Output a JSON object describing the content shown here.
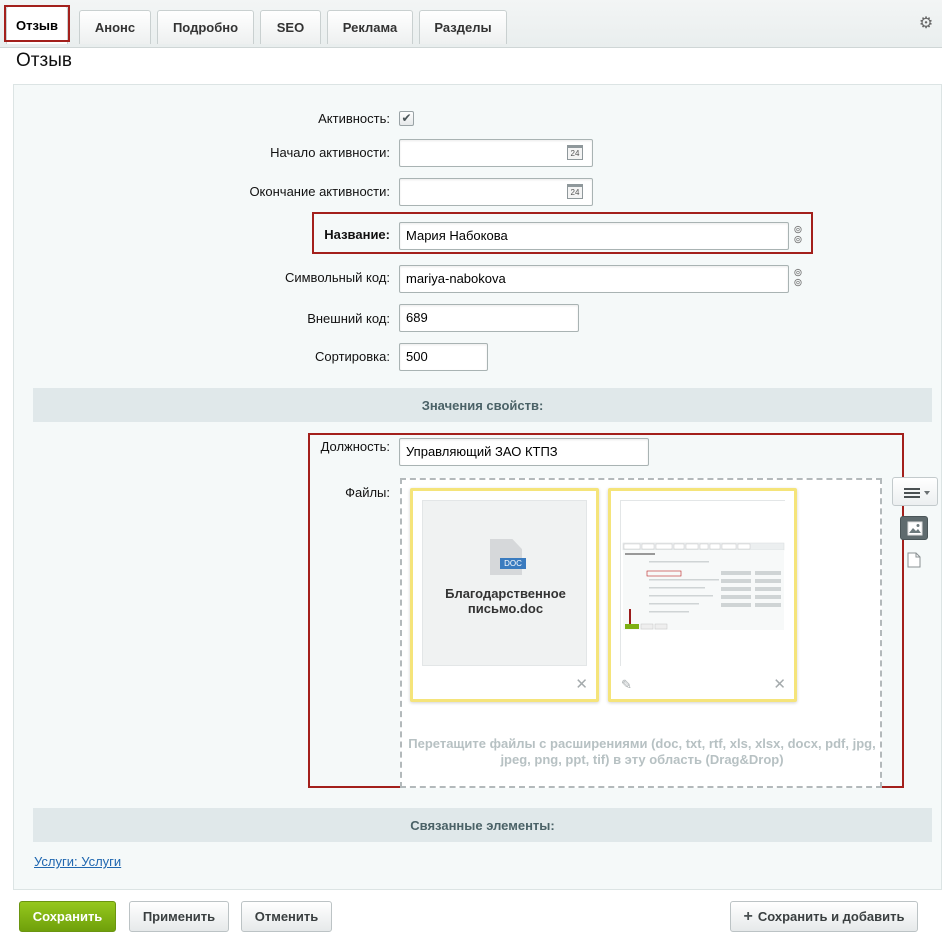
{
  "tabs": [
    {
      "label": "Отзыв",
      "active": true
    },
    {
      "label": "Анонс",
      "active": false
    },
    {
      "label": "Подробно",
      "active": false
    },
    {
      "label": "SEO",
      "active": false
    },
    {
      "label": "Реклама",
      "active": false
    },
    {
      "label": "Разделы",
      "active": false
    }
  ],
  "page_title": "Отзыв",
  "form": {
    "active_label": "Активность:",
    "active_checked": true,
    "active_from_label": "Начало активности:",
    "active_from_value": "",
    "active_to_label": "Окончание активности:",
    "active_to_value": "",
    "name_label": "Название:",
    "name_value": "Мария Набокова",
    "code_label": "Символьный код:",
    "code_value": "mariya-nabokova",
    "xml_id_label": "Внешний код:",
    "xml_id_value": "689",
    "sort_label": "Сортировка:",
    "sort_value": "500",
    "calendar_day": "24"
  },
  "properties": {
    "header": "Значения свойств:",
    "position_label": "Должность:",
    "position_value": "Управляющий ЗАО КТПЗ",
    "files_label": "Файлы:",
    "files": [
      {
        "name": "Благодарственное письмо.doc",
        "badge": "DOC",
        "icon": "doc-file-icon"
      },
      {
        "name": "",
        "icon": "image-thumbnail"
      }
    ],
    "drop_hint": "Перетащите файлы с расширениями (doc, txt, rtf, xls, xlsx, docx, pdf, jpg, jpeg, png, ppt, tif) в эту область (Drag&Drop)"
  },
  "related": {
    "header": "Связанные элементы:",
    "link_text": "Услуги: Услуги"
  },
  "buttons": {
    "save": "Сохранить",
    "apply": "Применить",
    "cancel": "Отменить",
    "save_add": "Сохранить и добавить"
  },
  "colors": {
    "highlight": "#a3201c",
    "save_green": "#7db013",
    "file_card_border": "#f5e47a",
    "link": "#2067b0"
  }
}
